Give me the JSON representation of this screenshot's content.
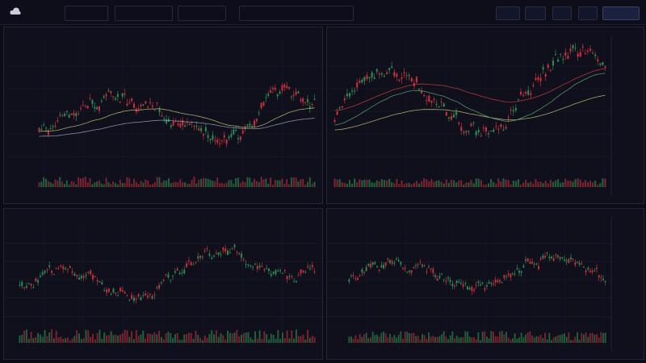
{
  "colors": {
    "up": "#2e8b52",
    "down": "#c8303a",
    "volume_up": "#2a7a48",
    "volume_down": "#9c2a36",
    "ma_fast": "#c8c070",
    "ma_slow": "#9aa2c0",
    "ma_red": "#c84040",
    "ma_green": "#5ca870"
  },
  "toolbar": {
    "logo": "cloud-icon"
  },
  "panels": [
    {
      "id": "top-left"
    },
    {
      "id": "top-right"
    },
    {
      "id": "bottom-left"
    },
    {
      "id": "bottom-right"
    }
  ]
}
